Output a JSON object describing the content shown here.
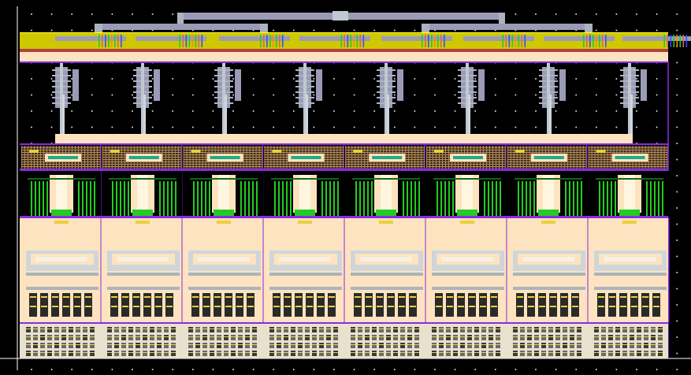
{
  "view": {
    "type": "ic-layout-viewer",
    "columns": 8,
    "grid_dots": true,
    "colors": {
      "background": "#000000",
      "frame": "#ffffff",
      "metal_top": "#cfc800",
      "metal_top_edge": "#ffff40",
      "route": "#9b9bb8",
      "route_light": "#c0c8d0",
      "tan": "#fde3bf",
      "tan_dark": "#e8c99a",
      "purple": "#8a2be2",
      "green": "#22cc22",
      "green_dark": "#116611",
      "mesh": "#b58c5a",
      "gray": "#aab4bc",
      "yellow_line": "#e8d23a"
    }
  }
}
